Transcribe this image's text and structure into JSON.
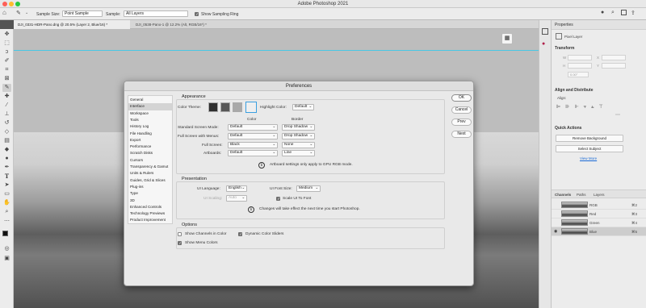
{
  "window": {
    "title": "Adobe Photoshop 2021"
  },
  "options_bar": {
    "sample_size_label": "Sample Size:",
    "sample_size_value": "Point Sample",
    "sample_label": "Sample:",
    "sample_value": "All Layers",
    "show_sampling_ring": "Show Sampling Ring"
  },
  "doc_tabs": [
    {
      "label": "DJI_0331-HDR-Pano.dng @ 20.5% (Layer 2, Blue/16) *"
    },
    {
      "label": "DJI_0538-Pano-1 @ 12.2% (Alt, RGB/16*) *"
    }
  ],
  "preferences": {
    "title": "Preferences",
    "nav": [
      "General",
      "Interface",
      "Workspace",
      "Tools",
      "History Log",
      "File Handling",
      "Export",
      "Performance",
      "Scratch Disks",
      "Cursors",
      "Transparency & Gamut",
      "Units & Rulers",
      "Guides, Grid & Slices",
      "Plug-ins",
      "Type",
      "3D",
      "Enhanced Controls",
      "Technology Previews",
      "Product Improvement"
    ],
    "buttons": {
      "ok": "OK",
      "cancel": "Cancel",
      "prev": "Prev",
      "next": "Next"
    },
    "appearance": {
      "title": "Appearance",
      "color_theme_label": "Color Theme:",
      "highlight_color_label": "Highlight Color:",
      "highlight_color_value": "Default",
      "col_color": "Color",
      "col_border": "Border",
      "rows": [
        {
          "label": "Standard Screen Mode:",
          "color": "Default",
          "border": "Drop Shadow"
        },
        {
          "label": "Full Screen with Menus:",
          "color": "Default",
          "border": "Drop Shadow"
        },
        {
          "label": "Full Screen:",
          "color": "Black",
          "border": "None"
        },
        {
          "label": "Artboards:",
          "color": "Default",
          "border": "Line"
        }
      ],
      "note": "Artboard settings only apply to GPU RGB mode.",
      "theme_colors": [
        "#2f2f2f",
        "#575757",
        "#a9a9a9",
        "#efefef"
      ]
    },
    "presentation": {
      "title": "Presentation",
      "ui_language_label": "UI Language:",
      "ui_language_value": "English",
      "ui_font_size_label": "UI Font Size:",
      "ui_font_size_value": "Medium",
      "ui_scaling_label": "UI Scaling:",
      "ui_scaling_value": "Auto",
      "scale_ui_to_font": "Scale UI To Font",
      "note": "Changes will take effect the next time you start Photoshop."
    },
    "options": {
      "title": "Options",
      "show_channels_in_color": "Show Channels in Color",
      "dynamic_color_sliders": "Dynamic Color Sliders",
      "show_menu_colors": "Show Menu Colors"
    }
  },
  "right_panel": {
    "properties_tab": "Properties",
    "layer_type": "Pixel Layer",
    "transform": "Transform",
    "align_distribute": "Align and Distribute",
    "align_label": "Align:",
    "quick_actions": "Quick Actions",
    "remove_background": "Remove Background",
    "select_subject": "Select Subject",
    "view_more": "View More",
    "field_w": "W",
    "field_h": "H",
    "field_x": "X",
    "field_y": "Y",
    "angle": "0.00°",
    "channels_tabs": [
      "Channels",
      "Paths",
      "Layers"
    ],
    "channels": [
      {
        "name": "RGB",
        "shortcut": "⌘2"
      },
      {
        "name": "Red",
        "shortcut": "⌘3"
      },
      {
        "name": "Green",
        "shortcut": "⌘4"
      },
      {
        "name": "Blue",
        "shortcut": "⌘5"
      }
    ]
  },
  "colors": {
    "guide": "#48c7e4",
    "mac_close": "#fe5f57",
    "mac_min": "#febc2e",
    "mac_max": "#28c840"
  }
}
